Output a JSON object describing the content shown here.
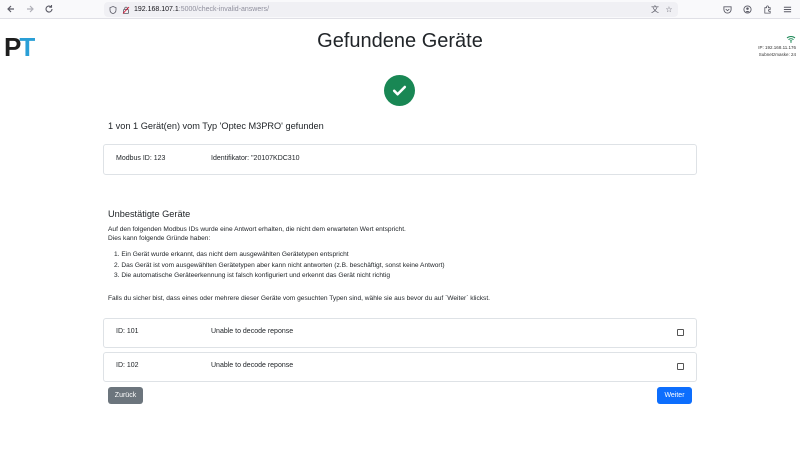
{
  "browser": {
    "url_host": "192.168.107.1",
    "url_rest": ":5000/check-invalid-answers/"
  },
  "logo": {
    "p": "P",
    "t": "T"
  },
  "network": {
    "ip": "IP: 192.168.11.176",
    "subnet": "Subnetzmaske: 24"
  },
  "page": {
    "title": "Gefundene Geräte",
    "found_summary": "1 von 1 Gerät(en) vom Typ 'Optec M3PRO' gefunden"
  },
  "found_devices": [
    {
      "id": "Modbus ID: 123",
      "identifier": "Identifikator: \"20107KDC310"
    }
  ],
  "unconfirmed": {
    "title": "Unbestätigte Geräte",
    "intro_line1": "Auf den folgenden Modbus IDs wurde eine Antwort erhalten, die nicht dem erwarteten Wert entspricht.",
    "intro_line2": "Dies kann folgende Gründe haben:",
    "reasons": [
      "1. Ein Gerät wurde erkannt, das nicht dem ausgewählten Gerätetypen entspricht",
      "2. Das Gerät ist vom ausgewählten Gerätetypen aber kann nicht antworten (z.B. beschäftigt, sonst keine Antwort)",
      "3. Die automatische Geräteerkennung ist falsch konfiguriert und erkennt das Gerät nicht richtig"
    ],
    "hint": "Falls du sicher bist, dass eines oder mehrere dieser Geräte vom gesuchten Typen sind, wähle sie aus bevor du auf `Weiter` klickst.",
    "devices": [
      {
        "id": "ID: 101",
        "message": "Unable to decode reponse"
      },
      {
        "id": "ID: 102",
        "message": "Unable to decode reponse"
      }
    ]
  },
  "buttons": {
    "back": "Zurück",
    "next": "Weiter"
  },
  "colors": {
    "success": "#198754",
    "primary": "#0d6efd",
    "secondary": "#6c757d",
    "logo_accent": "#2a9fd6"
  }
}
